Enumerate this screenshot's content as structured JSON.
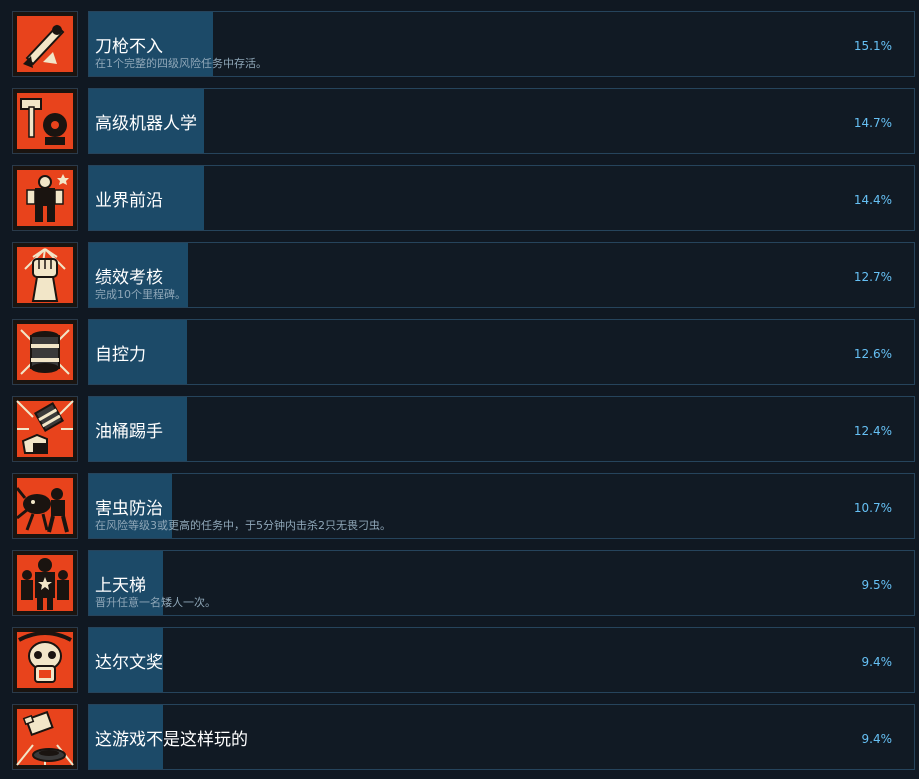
{
  "achievements": [
    {
      "title": "刀枪不入",
      "desc": "在1个完整的四级风险任务中存活。",
      "percent_text": "15.1%",
      "percent": 15.1,
      "icon": "rocket-shield-icon"
    },
    {
      "title": "高级机器人学",
      "desc": "",
      "percent_text": "14.7%",
      "percent": 14.7,
      "icon": "hammer-robot-icon"
    },
    {
      "title": "业界前沿",
      "desc": "",
      "percent_text": "14.4%",
      "percent": 14.4,
      "icon": "mech-suit-icon"
    },
    {
      "title": "绩效考核",
      "desc": "完成10个里程碑。",
      "percent_text": "12.7%",
      "percent": 12.7,
      "icon": "raised-fist-icon"
    },
    {
      "title": "自控力",
      "desc": "",
      "percent_text": "12.6%",
      "percent": 12.6,
      "icon": "barrel-icon"
    },
    {
      "title": "油桶踢手",
      "desc": "",
      "percent_text": "12.4%",
      "percent": 12.4,
      "icon": "barrel-kick-icon"
    },
    {
      "title": "害虫防治",
      "desc": "在风险等级3或更高的任务中，于5分钟内击杀2只无畏刁虫。",
      "percent_text": "10.7%",
      "percent": 10.7,
      "icon": "bug-fight-icon"
    },
    {
      "title": "上天梯",
      "desc": "晋升任意一名矮人一次。",
      "percent_text": "9.5%",
      "percent": 9.5,
      "icon": "dwarf-group-icon"
    },
    {
      "title": "达尔文奖",
      "desc": "",
      "percent_text": "9.4%",
      "percent": 9.4,
      "icon": "skull-icon"
    },
    {
      "title": "这游戏不是这样玩的",
      "desc": "",
      "percent_text": "9.4%",
      "percent": 9.4,
      "icon": "broken-drill-icon"
    }
  ],
  "colors": {
    "background": "#101822",
    "bar_fill": "#1c4a68",
    "bar_border": "#26445c",
    "percent_text": "#66c0f4",
    "icon_red": "#e8431c",
    "icon_cream": "#f2e6c8"
  }
}
